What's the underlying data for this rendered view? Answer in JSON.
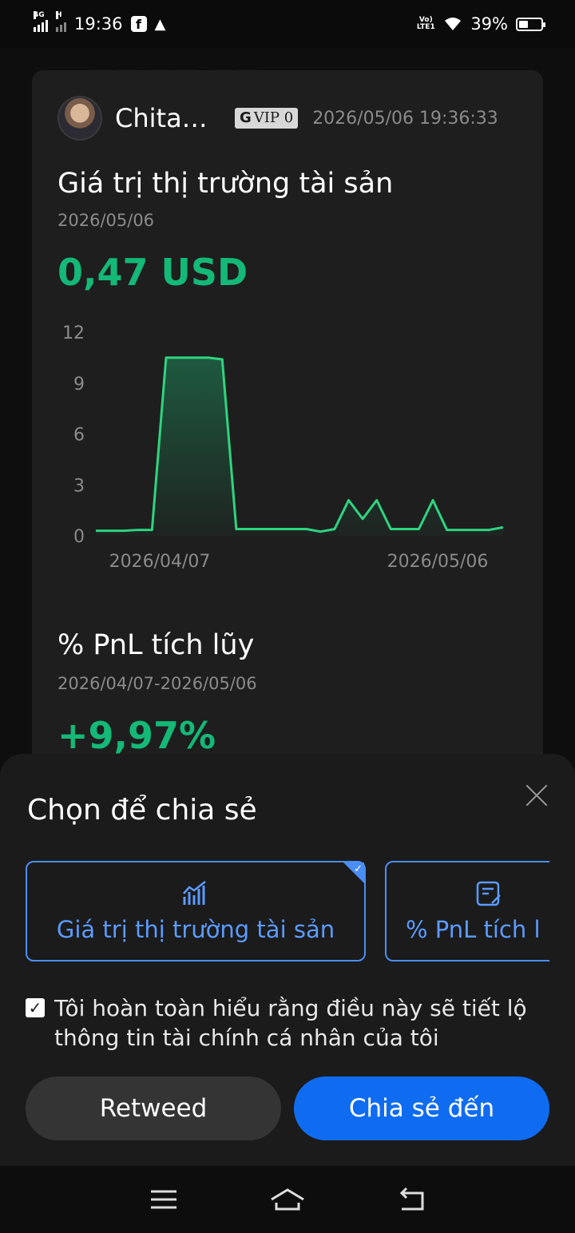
{
  "status_bar": {
    "network": "4G",
    "network2": "H",
    "time": "19:36",
    "volte": "Vo) LTE1",
    "battery": "39%"
  },
  "card": {
    "username": "Chita…",
    "vip_label": "VIP 0",
    "timestamp": "2026/05/06 19:36:33",
    "market_title": "Giá trị thị trường tài sản",
    "market_date": "2026/05/06",
    "market_value": "0,47 USD",
    "pnl_title": "% PnL tích lũy",
    "pnl_range": "2026/04/07-2026/05/06",
    "pnl_value": "+9,97%"
  },
  "chart_data": {
    "type": "area",
    "y_ticks": [
      "12",
      "9",
      "6",
      "3",
      "0"
    ],
    "ylim": [
      0,
      12
    ],
    "x_tick_labels": [
      "2026/04/07",
      "2026/05/06"
    ],
    "values": [
      0.3,
      0.3,
      0.3,
      0.35,
      0.35,
      10.5,
      10.5,
      10.5,
      10.5,
      10.4,
      0.4,
      0.4,
      0.4,
      0.4,
      0.4,
      0.4,
      0.25,
      0.4,
      2.1,
      1.0,
      2.1,
      0.4,
      0.4,
      0.4,
      2.1,
      0.35,
      0.35,
      0.35,
      0.35,
      0.5
    ],
    "line_color": "#2ed47f"
  },
  "sheet": {
    "title": "Chọn để chia sẻ",
    "option_1": "Giá trị thị trường tài sản",
    "option_2": "% PnL tích l",
    "consent": "Tôi hoàn toàn hiểu rằng điều này sẽ tiết lộ thông tin tài chính cá nhân của tôi",
    "retweet_label": "Retweed",
    "share_label": "Chia sẻ đến"
  },
  "colors": {
    "accent_green": "#14b877",
    "accent_blue": "#0f6cf1"
  }
}
